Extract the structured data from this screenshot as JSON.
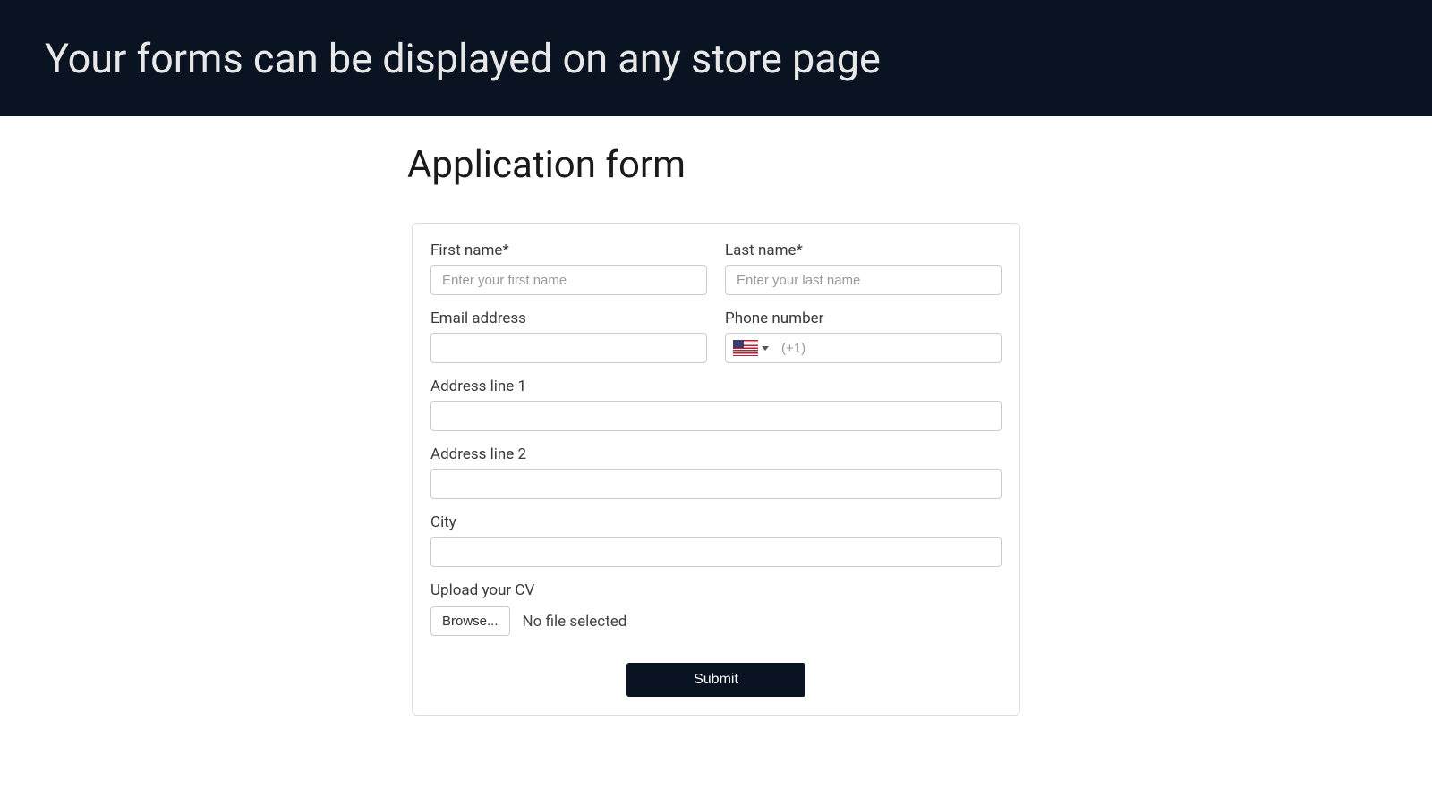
{
  "header": {
    "title": "Your forms can be displayed on any store page"
  },
  "form": {
    "title": "Application form",
    "first_name_label": "First name*",
    "first_name_placeholder": "Enter your first name",
    "last_name_label": "Last name*",
    "last_name_placeholder": "Enter your last name",
    "email_label": "Email address",
    "phone_label": "Phone number",
    "phone_placeholder": "(+1)",
    "address1_label": "Address line 1",
    "address2_label": "Address line 2",
    "city_label": "City",
    "upload_label": "Upload your CV",
    "browse_label": "Browse...",
    "file_status": "No file selected",
    "submit_label": "Submit"
  }
}
